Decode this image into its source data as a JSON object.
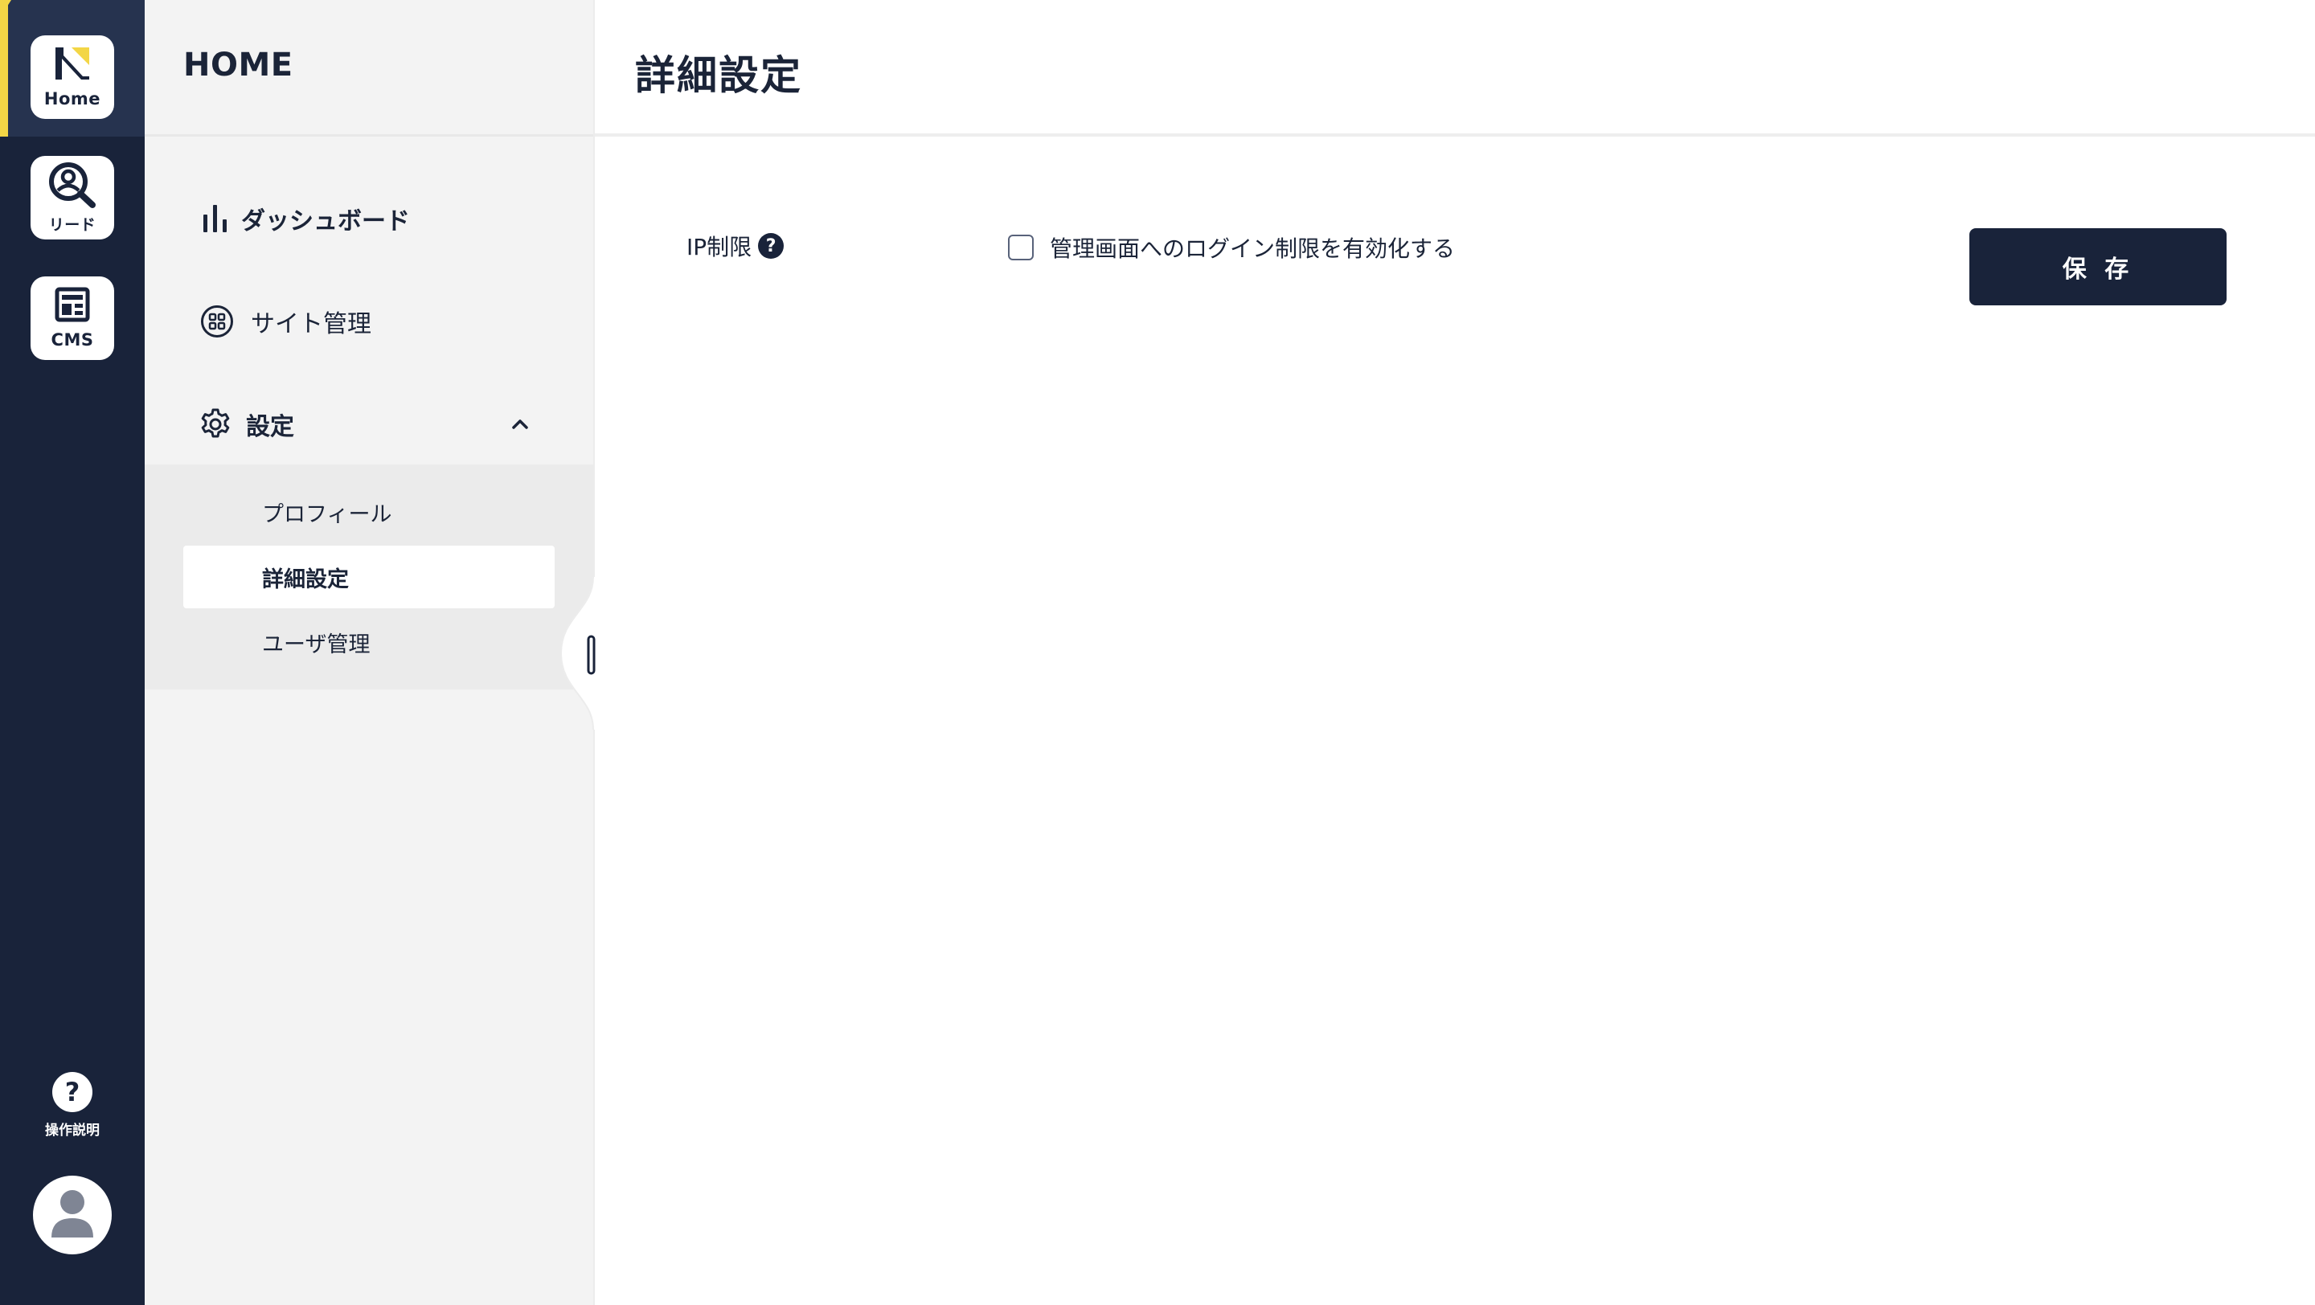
{
  "rail": {
    "items": [
      {
        "label": "Home"
      },
      {
        "label": "リード"
      },
      {
        "label": "CMS"
      }
    ],
    "help_symbol": "?",
    "help_label": "操作説明"
  },
  "sidebar": {
    "title": "HOME",
    "nav": [
      {
        "label": "ダッシュボード"
      },
      {
        "label": "サイト管理"
      },
      {
        "label": "設定"
      }
    ],
    "sub_items": [
      {
        "label": "プロフィール"
      },
      {
        "label": "詳細設定"
      },
      {
        "label": "ユーザ管理"
      }
    ]
  },
  "main": {
    "title": "詳細設定",
    "ip_label": "IP制限",
    "help_symbol": "?",
    "checkbox_label": "管理画面へのログイン制限を有効化する",
    "save_label": "保 存"
  },
  "colors": {
    "rail_bg": "#19233a",
    "accent_yellow": "#f3d646",
    "sidebar_bg": "#f3f3f3",
    "button_bg": "#19233a"
  }
}
